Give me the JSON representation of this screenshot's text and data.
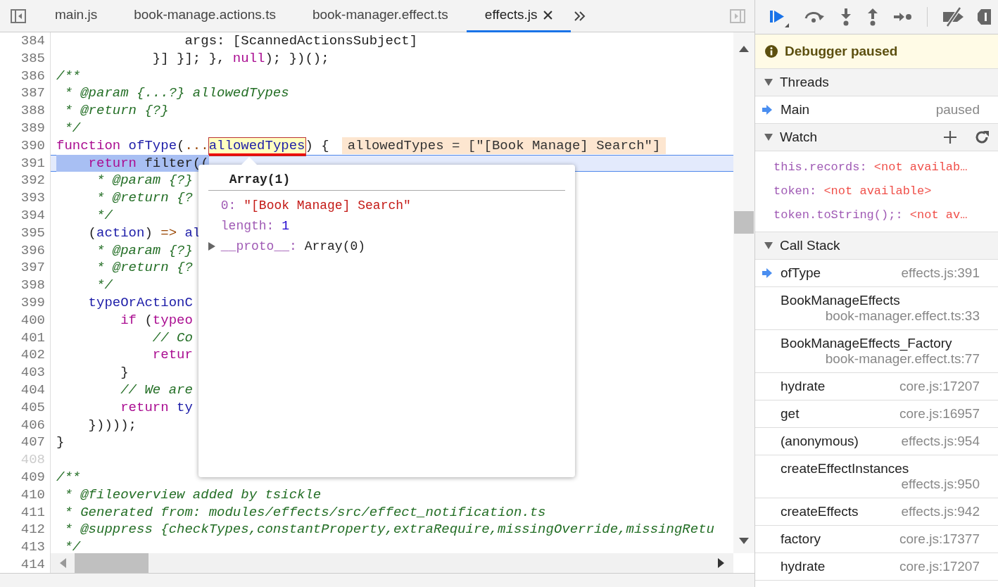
{
  "tabs": [
    {
      "label": "main.js",
      "selected": false,
      "closable": false
    },
    {
      "label": "book-manage.actions.ts",
      "selected": false,
      "closable": false
    },
    {
      "label": "book-manager.effect.ts",
      "selected": false,
      "closable": false
    },
    {
      "label": "effects.js",
      "selected": true,
      "closable": true
    }
  ],
  "editor": {
    "lines": [
      {
        "n": "384",
        "dim": false,
        "current": false,
        "t": [
          {
            "kind": "pl",
            "text": "                args: [ScannedActionsSubject]"
          }
        ]
      },
      {
        "n": "385",
        "dim": false,
        "current": false,
        "t": [
          {
            "kind": "pl",
            "text": "            }] }]; }, "
          },
          {
            "kind": "kw",
            "text": "null"
          },
          {
            "kind": "pl",
            "text": "); })();"
          }
        ]
      },
      {
        "n": "386",
        "dim": false,
        "current": false,
        "t": [
          {
            "kind": "cm",
            "text": "/**"
          }
        ]
      },
      {
        "n": "387",
        "dim": false,
        "current": false,
        "t": [
          {
            "kind": "cm",
            "text": " * @param {...?} allowedTypes"
          }
        ]
      },
      {
        "n": "388",
        "dim": false,
        "current": false,
        "t": [
          {
            "kind": "cm",
            "text": " * @return {?}"
          }
        ]
      },
      {
        "n": "389",
        "dim": false,
        "current": false,
        "t": [
          {
            "kind": "cm",
            "text": " */"
          }
        ]
      },
      {
        "n": "390",
        "dim": false,
        "current": false,
        "t": [
          {
            "kind": "kw",
            "text": "function"
          },
          {
            "kind": "def",
            "text": " ofType"
          },
          {
            "kind": "pl",
            "text": "("
          },
          {
            "kind": "op",
            "text": "..."
          },
          {
            "kind": "hover",
            "text": "allowedTypes"
          },
          {
            "kind": "pl",
            "text": ") {"
          }
        ],
        "inline_value": "allowedTypes = [\"[Book Manage] Search\"]"
      },
      {
        "n": "391",
        "dim": false,
        "current": true,
        "t": [
          {
            "kind": "kw",
            "text": "    return"
          },
          {
            "kind": "pl",
            "text": " filter(("
          }
        ]
      },
      {
        "n": "392",
        "dim": false,
        "current": false,
        "t": [
          {
            "kind": "cm",
            "text": "     * @param {?}"
          }
        ]
      },
      {
        "n": "393",
        "dim": false,
        "current": false,
        "t": [
          {
            "kind": "cm",
            "text": "     * @return {?"
          }
        ]
      },
      {
        "n": "394",
        "dim": false,
        "current": false,
        "t": [
          {
            "kind": "cm",
            "text": "     */"
          }
        ]
      },
      {
        "n": "395",
        "dim": false,
        "current": false,
        "t": [
          {
            "kind": "pl",
            "text": "    ("
          },
          {
            "kind": "def",
            "text": "action"
          },
          {
            "kind": "pl",
            "text": ") "
          },
          {
            "kind": "op",
            "text": "=>"
          },
          {
            "kind": "def",
            "text": " al"
          }
        ]
      },
      {
        "n": "396",
        "dim": false,
        "current": false,
        "t": [
          {
            "kind": "cm",
            "text": "     * @param {?}"
          }
        ]
      },
      {
        "n": "397",
        "dim": false,
        "current": false,
        "t": [
          {
            "kind": "cm",
            "text": "     * @return {?"
          }
        ]
      },
      {
        "n": "398",
        "dim": false,
        "current": false,
        "t": [
          {
            "kind": "cm",
            "text": "     */"
          }
        ]
      },
      {
        "n": "399",
        "dim": false,
        "current": false,
        "t": [
          {
            "kind": "def",
            "text": "    typeOrActionC"
          }
        ]
      },
      {
        "n": "400",
        "dim": false,
        "current": false,
        "t": [
          {
            "kind": "kw",
            "text": "        if"
          },
          {
            "kind": "pl",
            "text": " ("
          },
          {
            "kind": "kw",
            "text": "typeo"
          }
        ]
      },
      {
        "n": "401",
        "dim": false,
        "current": false,
        "t": [
          {
            "kind": "cm",
            "text": "            // Co"
          }
        ]
      },
      {
        "n": "402",
        "dim": false,
        "current": false,
        "t": [
          {
            "kind": "kw",
            "text": "            retur"
          }
        ]
      },
      {
        "n": "403",
        "dim": false,
        "current": false,
        "t": [
          {
            "kind": "pl",
            "text": "        }"
          }
        ]
      },
      {
        "n": "404",
        "dim": false,
        "current": false,
        "t": [
          {
            "kind": "cm",
            "text": "        // We are"
          }
        ]
      },
      {
        "n": "405",
        "dim": false,
        "current": false,
        "t": [
          {
            "kind": "kw",
            "text": "        return"
          },
          {
            "kind": "def",
            "text": " ty"
          }
        ]
      },
      {
        "n": "406",
        "dim": false,
        "current": false,
        "t": [
          {
            "kind": "pl",
            "text": "    }))));"
          }
        ]
      },
      {
        "n": "407",
        "dim": false,
        "current": false,
        "t": [
          {
            "kind": "pl",
            "text": "}"
          }
        ]
      },
      {
        "n": "408",
        "dim": true,
        "current": false
      },
      {
        "n": "409",
        "dim": false,
        "current": false,
        "t": [
          {
            "kind": "cm",
            "text": "/**"
          }
        ]
      },
      {
        "n": "410",
        "dim": false,
        "current": false,
        "t": [
          {
            "kind": "cm",
            "text": " * @fileoverview added by tsickle"
          }
        ]
      },
      {
        "n": "411",
        "dim": false,
        "current": false,
        "t": [
          {
            "kind": "cm",
            "text": " * Generated from: modules/effects/src/effect_notification.ts"
          }
        ]
      },
      {
        "n": "412",
        "dim": false,
        "current": false,
        "t": [
          {
            "kind": "cm",
            "text": " * @suppress {checkTypes,constantProperty,extraRequire,missingOverride,missingRetu"
          }
        ]
      },
      {
        "n": "413",
        "dim": false,
        "current": false,
        "t": [
          {
            "kind": "cm",
            "text": " */"
          }
        ]
      },
      {
        "n": "414",
        "dim": false,
        "current": false
      }
    ],
    "popover": {
      "title": "Array(1)",
      "props": [
        {
          "key": "0:",
          "kind": "string",
          "value": "\"[Book Manage] Search\"",
          "expandable": false
        },
        {
          "key": "length:",
          "kind": "number",
          "value": "1",
          "expandable": false
        },
        {
          "key": "__proto__:",
          "kind": "object",
          "value": "Array(0)",
          "expandable": true
        }
      ]
    }
  },
  "sidebar": {
    "banner": "Debugger paused",
    "threads": {
      "title": "Threads",
      "expanded": true,
      "items": [
        {
          "name": "Main",
          "status": "paused",
          "current": true
        }
      ]
    },
    "watch": {
      "title": "Watch",
      "expanded": true,
      "items": [
        {
          "expression": "this.records:",
          "value": "<not availab…"
        },
        {
          "expression": "token:",
          "value": "<not available>"
        },
        {
          "expression": "token.toString();:",
          "value": "<not av…"
        }
      ]
    },
    "call_stack": {
      "title": "Call Stack",
      "expanded": true,
      "frames": [
        {
          "name": "ofType",
          "location": "effects.js:391",
          "current": true
        },
        {
          "name": "BookManageEffects",
          "location": "book-manager.effect.ts:33",
          "current": false
        },
        {
          "name": "BookManageEffects_Factory",
          "location": "book-manager.effect.ts:77",
          "current": false
        },
        {
          "name": "hydrate",
          "location": "core.js:17207",
          "current": false
        },
        {
          "name": "get",
          "location": "core.js:16957",
          "current": false
        },
        {
          "name": "(anonymous)",
          "location": "effects.js:954",
          "current": false
        },
        {
          "name": "createEffectInstances",
          "location": "effects.js:950",
          "current": false
        },
        {
          "name": "createEffects",
          "location": "effects.js:942",
          "current": false
        },
        {
          "name": "factory",
          "location": "core.js:17377",
          "current": false
        },
        {
          "name": "hydrate",
          "location": "core.js:17207",
          "current": false
        }
      ]
    }
  }
}
